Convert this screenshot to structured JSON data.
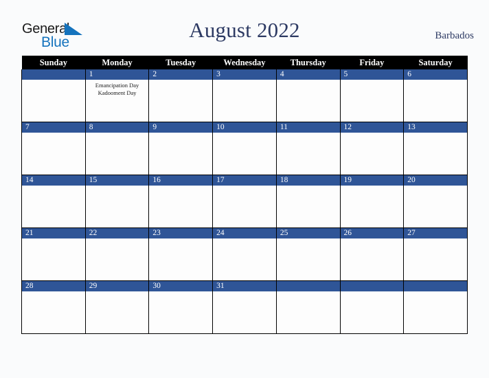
{
  "brand": {
    "logo_text_top": "General",
    "logo_text_bottom": "Blue",
    "logo_triangle_icon": "triangle-icon",
    "accent_color": "#1573bd"
  },
  "header": {
    "title": "August 2022",
    "country": "Barbados",
    "title_color": "#2d3a63"
  },
  "calendar": {
    "weekday_headers": [
      "Sunday",
      "Monday",
      "Tuesday",
      "Wednesday",
      "Thursday",
      "Friday",
      "Saturday"
    ],
    "header_bg": "#000000",
    "daybar_bg": "#2f5597",
    "weeks": [
      [
        {
          "date": "",
          "events": []
        },
        {
          "date": "1",
          "events": [
            "Emancipation Day",
            "Kadooment Day"
          ]
        },
        {
          "date": "2",
          "events": []
        },
        {
          "date": "3",
          "events": []
        },
        {
          "date": "4",
          "events": []
        },
        {
          "date": "5",
          "events": []
        },
        {
          "date": "6",
          "events": []
        }
      ],
      [
        {
          "date": "7",
          "events": []
        },
        {
          "date": "8",
          "events": []
        },
        {
          "date": "9",
          "events": []
        },
        {
          "date": "10",
          "events": []
        },
        {
          "date": "11",
          "events": []
        },
        {
          "date": "12",
          "events": []
        },
        {
          "date": "13",
          "events": []
        }
      ],
      [
        {
          "date": "14",
          "events": []
        },
        {
          "date": "15",
          "events": []
        },
        {
          "date": "16",
          "events": []
        },
        {
          "date": "17",
          "events": []
        },
        {
          "date": "18",
          "events": []
        },
        {
          "date": "19",
          "events": []
        },
        {
          "date": "20",
          "events": []
        }
      ],
      [
        {
          "date": "21",
          "events": []
        },
        {
          "date": "22",
          "events": []
        },
        {
          "date": "23",
          "events": []
        },
        {
          "date": "24",
          "events": []
        },
        {
          "date": "25",
          "events": []
        },
        {
          "date": "26",
          "events": []
        },
        {
          "date": "27",
          "events": []
        }
      ],
      [
        {
          "date": "28",
          "events": []
        },
        {
          "date": "29",
          "events": []
        },
        {
          "date": "30",
          "events": []
        },
        {
          "date": "31",
          "events": []
        },
        {
          "date": "",
          "events": []
        },
        {
          "date": "",
          "events": []
        },
        {
          "date": "",
          "events": []
        }
      ]
    ]
  }
}
